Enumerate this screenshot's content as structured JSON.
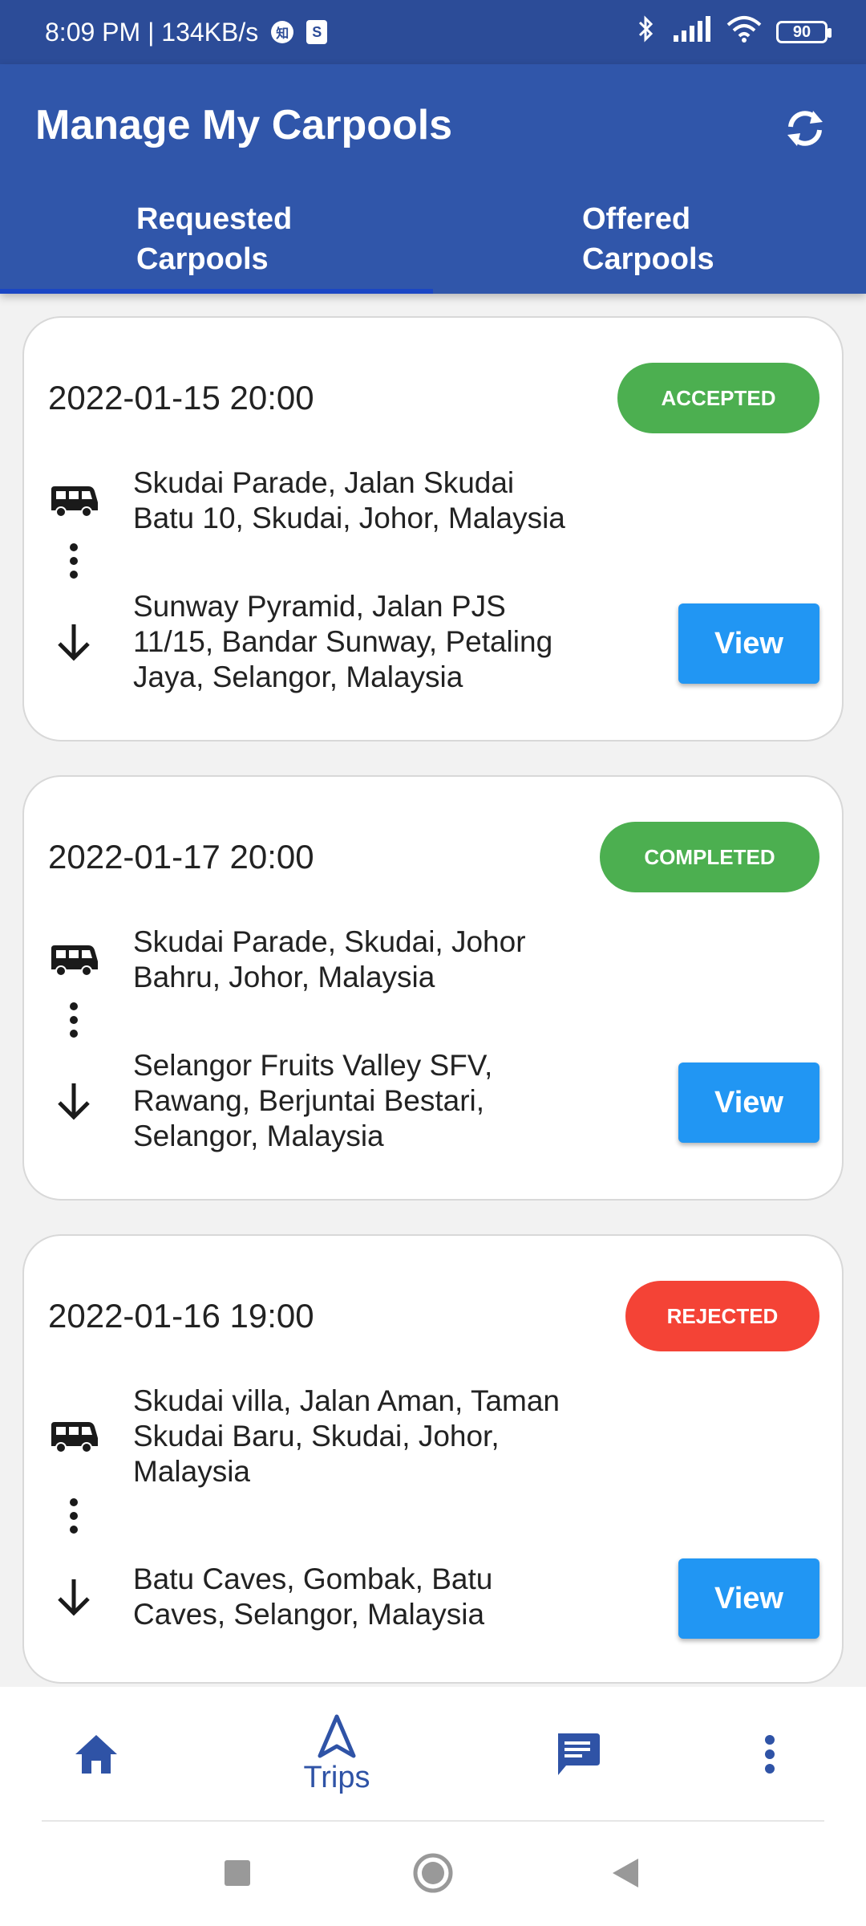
{
  "status_bar": {
    "time_speed": "8:09 PM | 134KB/s",
    "app_chip": "知",
    "shop_chip": "S",
    "battery": "90"
  },
  "header": {
    "title": "Manage My Carpools",
    "tabs": [
      {
        "line1": "Requested",
        "line2": "Carpools"
      },
      {
        "line1": "Offered",
        "line2": "Carpools"
      }
    ]
  },
  "carpools": [
    {
      "datetime": "2022-01-15 20:00",
      "status": "ACCEPTED",
      "status_color": "#4caf50",
      "origin": "Skudai Parade, Jalan Skudai Batu 10, Skudai, Johor, Malaysia",
      "destination": "Sunway Pyramid, Jalan PJS 11/15, Bandar Sunway, Petaling Jaya, Selangor, Malaysia",
      "view_label": "View"
    },
    {
      "datetime": "2022-01-17 20:00",
      "status": "COMPLETED",
      "status_color": "#4caf50",
      "origin": "Skudai Parade, Skudai, Johor Bahru, Johor, Malaysia",
      "destination": "Selangor Fruits Valley SFV, Rawang, Berjuntai Bestari, Selangor, Malaysia",
      "view_label": "View"
    },
    {
      "datetime": "2022-01-16 19:00",
      "status": "REJECTED",
      "status_color": "#f44336",
      "origin": "Skudai villa, Jalan Aman, Taman Skudai Baru, Skudai, Johor, Malaysia",
      "destination": "Batu Caves, Gombak, Batu Caves, Selangor, Malaysia",
      "view_label": "View"
    }
  ],
  "bottom_nav": {
    "trips_label": "Trips",
    "accent": "#2f53a6"
  }
}
